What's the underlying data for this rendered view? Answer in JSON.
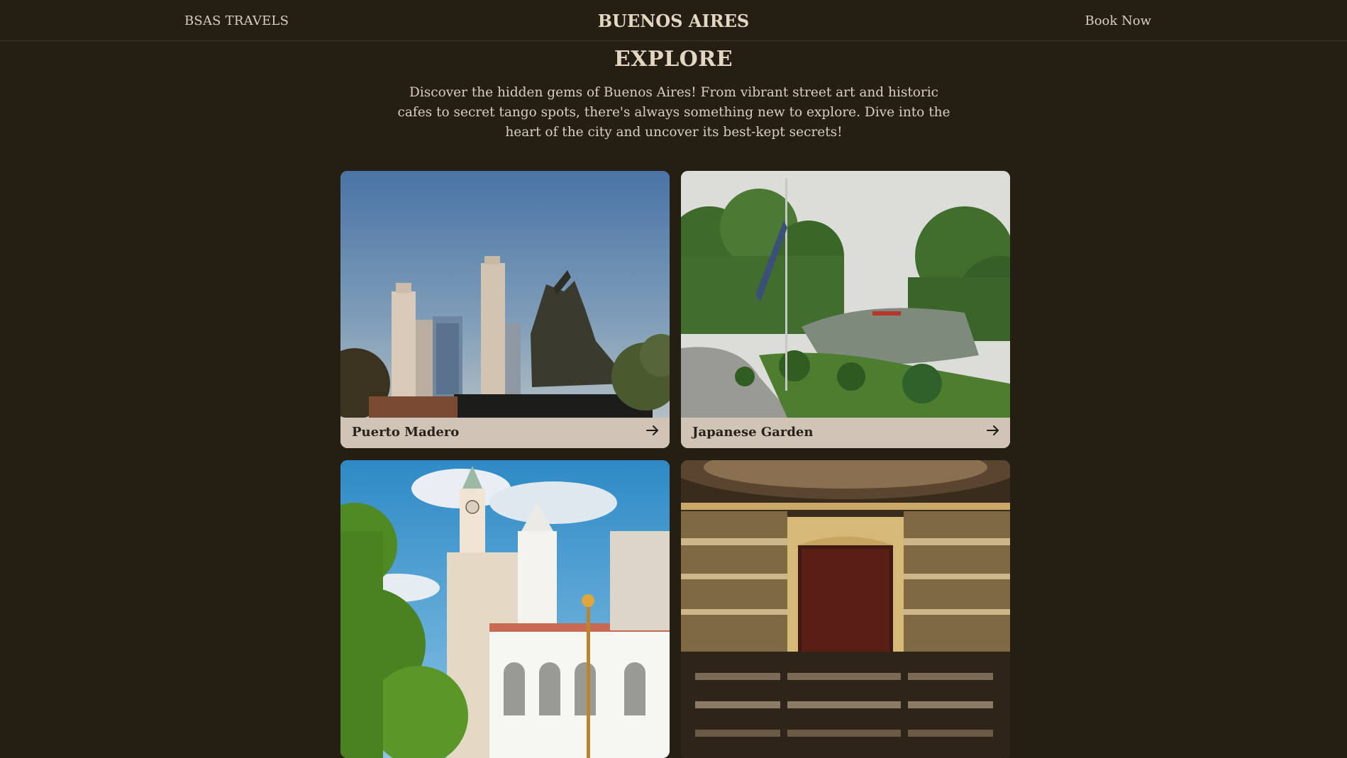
{
  "header": {
    "brand": "BSAS TRAVELS",
    "title": "BUENOS AIRES",
    "cta": "Book Now"
  },
  "explore": {
    "title": "EXPLORE",
    "intro": "Discover the hidden gems of Buenos Aires! From vibrant street art and historic cafes to secret tango spots, there's always something new to explore. Dive into the heart of the city and uncover its best-kept secrets!"
  },
  "cards": [
    {
      "name": "Puerto Madero"
    },
    {
      "name": "Japanese Garden"
    },
    {
      "name": ""
    },
    {
      "name": ""
    }
  ],
  "colors": {
    "background": "#251e13",
    "text": "#d8cfc0",
    "card_caption": "#cfc4b6",
    "caption_text": "#2a2218"
  },
  "icons": {
    "card_link": "arrow-right-icon"
  }
}
